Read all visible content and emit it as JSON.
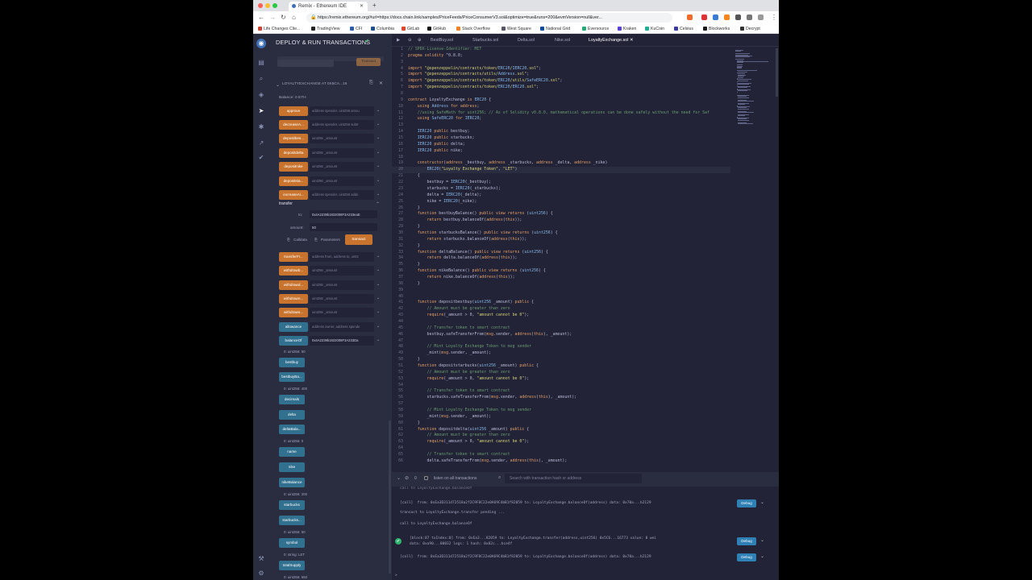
{
  "browser": {
    "tab_title": "Remix - Ethereum IDE",
    "url": "https://remix.ethereum.org/#url=https://docs.chain.link/samples/PriceFeeds/PriceConsumerV3.sol&optimize=true&runs=200&evmVersion=null&ver...",
    "bookmarks": [
      "Life Changes Clie...",
      "TradingView",
      "CFI",
      "Columbia",
      "GitLab",
      "GitHub",
      "Stack Overflow",
      "West Square",
      "National Grid",
      "Eversource",
      "Kraken",
      "KuCoin",
      "Celsius",
      "Blockworks",
      "Decrypt"
    ]
  },
  "panel": {
    "title": "DEPLOY & RUN TRANSACTIONS",
    "transact_top": "Transact",
    "instance_title": "LOYALTYEXCHANGE AT 0X5CA...16",
    "balance": "Balance: 0 ETH",
    "functions": [
      {
        "label": "approve",
        "placeholder": "address spender, uint256 amou",
        "color": "orange"
      },
      {
        "label": "decreaseA...",
        "placeholder": "address spender, uint256 subtr",
        "color": "orange"
      },
      {
        "label": "depositbes...",
        "placeholder": "uint256 _amount",
        "color": "orange"
      },
      {
        "label": "depositdelta",
        "placeholder": "uint256 _amount",
        "color": "orange"
      },
      {
        "label": "depositnike",
        "placeholder": "uint256 _amount",
        "color": "orange"
      },
      {
        "label": "depositsta...",
        "placeholder": "uint256 _amount",
        "color": "orange"
      },
      {
        "label": "increaseAl...",
        "placeholder": "address spender, uint256 adde",
        "color": "orange"
      }
    ],
    "transfer": {
      "label": "transfer",
      "to_label": "to:",
      "to_value": "0x4A2239b1822008F3A233eaE",
      "amount_label": "amount:",
      "amount_value": "50",
      "calldata": "Calldata",
      "parameters": "Parameters",
      "transact": "transact"
    },
    "functions2": [
      {
        "label": "transferFr...",
        "placeholder": "address from, address to, uint2",
        "color": "orange"
      },
      {
        "label": "withdrawb...",
        "placeholder": "uint256 _amount",
        "color": "orange"
      },
      {
        "label": "withdrawd...",
        "placeholder": "uint256 _amount",
        "color": "orange"
      },
      {
        "label": "withdrawn...",
        "placeholder": "uint256 _amount",
        "color": "orange"
      },
      {
        "label": "withdraws...",
        "placeholder": "uint256 _amount",
        "color": "orange"
      },
      {
        "label": "allowance",
        "placeholder": "address owner, address spende",
        "color": "blue"
      },
      {
        "label": "balanceOf",
        "placeholder": "0x4A2239b1822008F3A233Da",
        "color": "blue"
      }
    ],
    "calls": [
      {
        "label": "bestbuy",
        "result": ""
      },
      {
        "label": "bestbuyBa...",
        "result": "0: uint256: 400"
      },
      {
        "label": "decimals",
        "result": ""
      },
      {
        "label": "delta",
        "result": ""
      },
      {
        "label": "deltaBala...",
        "result": "0: uint256: 0"
      },
      {
        "label": "name",
        "result": ""
      },
      {
        "label": "nike",
        "result": ""
      },
      {
        "label": "nikeBalance",
        "result": "0: uint256: 200"
      },
      {
        "label": "starbucks",
        "result": ""
      },
      {
        "label": "starbucks...",
        "result": "0: uint256: 50"
      },
      {
        "label": "symbol",
        "result": "0: string: LET"
      },
      {
        "label": "totalSupply",
        "result": "0: uint256: 650"
      }
    ],
    "balanceof_result": "0: uint256: 50"
  },
  "editor": {
    "tabs": [
      "BestBuy.sol",
      "Starbucks.sol",
      "Delta.sol",
      "Nike.sol",
      "LoyaltyExchange.sol"
    ],
    "active_tab": "LoyaltyExchange.sol",
    "lines": [
      "// SPDX-License-Identifier: MIT",
      "pragma solidity ^0.8.0;",
      "",
      "import \"@openzeppelin/contracts/token/ERC20/IERC20.sol\";",
      "import \"@openzeppelin/contracts/utils/Address.sol\";",
      "import \"@openzeppelin/contracts/token/ERC20/utils/SafeERC20.sol\";",
      "import \"@openzeppelin/contracts/token/ERC20/ERC20.sol\";",
      "",
      "contract LoyaltyExchange is ERC20 {",
      "    using Address for address;",
      "    //using SafeMath for uint256; // As of Solidity v0.8.0, mathematical operations can be done safely without the need for Saf",
      "    using SafeERC20 for IERC20;",
      "",
      "    IERC20 public bestbuy;",
      "    IERC20 public starbucks;",
      "    IERC20 public delta;",
      "    IERC20 public nike;",
      "",
      "    constructor(address _bestbuy, address _starbucks, address _delta, address _nike)",
      "        ERC20(\"Loyalty Exchange Token\", \"LET\")",
      "    {",
      "        bestbuy = IERC20(_bestbuy);",
      "        starbucks = IERC20(_starbucks);",
      "        delta = IERC20(_delta);",
      "        nike = IERC20(_nike);",
      "    }",
      "    function bestbuyBalance() public view returns (uint256) {",
      "        return bestbuy.balanceOf(address(this));",
      "    }",
      "    function starbucksBalance() public view returns (uint256) {",
      "        return starbucks.balanceOf(address(this));",
      "    }",
      "    function deltaBalance() public view returns (uint256) {",
      "        return delta.balanceOf(address(this));",
      "    }",
      "    function nikeBalance() public view returns (uint256) {",
      "        return nike.balanceOf(address(this));",
      "    }",
      "",
      "",
      "    function depositbestbuy(uint256 _amount) public {",
      "        // Amount must be greater than zero",
      "        require(_amount > 0, \"amount cannot be 0\");",
      "",
      "        // Transfer token to smart contract",
      "        bestbuy.safeTransferFrom(msg.sender, address(this), _amount);",
      "",
      "        // Mint Loyalty Exchange Token to msg sender",
      "        _mint(msg.sender, _amount);",
      "    }",
      "    function depositstarbucks(uint256 _amount) public {",
      "        // Amount must be greater than zero",
      "        require(_amount > 0, \"amount cannot be 0\");",
      "",
      "        // Transfer token to smart contract",
      "        starbucks.safeTransferFrom(msg.sender, address(this), _amount);",
      "",
      "        // Mint Loyalty Exchange Token to msg sender",
      "        _mint(msg.sender, _amount);",
      "    }",
      "    function depositdelta(uint256 _amount) public {",
      "        // Amount must be greater than zero",
      "        require(_amount > 0, \"amount cannot be 0\");",
      "",
      "        // Transfer token to smart contract",
      "        delta.safeTransferFrom(msg.sender, address(this), _amount);"
    ],
    "highlight_line": 20
  },
  "terminal": {
    "counter": "0",
    "listen_label": "listen on all transactions",
    "search_placeholder": "Search with transaction hash or address",
    "entries": [
      {
        "kind": "text",
        "text": "call to LoyaltyExchange.balanceOf"
      },
      {
        "kind": "call",
        "text": "[call]  from: 0xEa3D311d72518a2f2C9F8C22e0A69C4bB1f82059 to: LoyaltyExchange.balanceOf(address) data: 0x70a...b2129",
        "debug": true
      },
      {
        "kind": "text",
        "text": "transact to LoyaltyExchange.transfer pending ..."
      },
      {
        "kind": "text",
        "text": "call to LoyaltyExchange.balanceOf"
      },
      {
        "kind": "ok",
        "text": "[block:87 txIndex:0] from: 0xEa3...82059 to: LoyaltyExchange.transfer(address,uint256) 0x5C6...16773 value: 0 wei",
        "text2": "data: 0xa90...00032 logs: 1 hash: 0x82c...bce4f",
        "debug": true
      },
      {
        "kind": "call",
        "text": "[call]  from: 0xEa3D311d72518a2f2C9F8C22e0A69C4bB1f82059 to: LoyaltyExchange.balanceOf(address) data: 0x70a...b2129",
        "debug": true
      }
    ],
    "debug_label": "Debug",
    "prompt": ">"
  }
}
